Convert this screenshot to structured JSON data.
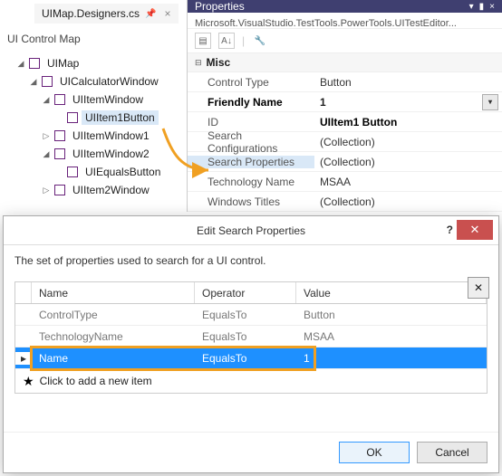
{
  "tab": {
    "title": "UIMap.Designers.cs"
  },
  "leftPanel": {
    "title": "UI Control Map"
  },
  "tree": {
    "n0": "UIMap",
    "n1": "UICalculatorWindow",
    "n2": "UIItemWindow",
    "n3": "UIItem1Button",
    "n4": "UIItemWindow1",
    "n5": "UIItemWindow2",
    "n6": "UIEqualsButton",
    "n7": "UIItem2Window"
  },
  "props": {
    "title": "Properties",
    "sub": "Microsoft.VisualStudio.TestTools.PowerTools.UITestEditor...",
    "cat": "Misc",
    "rows": {
      "controlTypeL": "Control Type",
      "controlTypeV": "Button",
      "friendlyL": "Friendly Name",
      "friendlyV": "1",
      "idL": "ID",
      "idV": "UIItem1 Button",
      "searchCfgL": "Search Configurations",
      "searchCfgV": "(Collection)",
      "searchPropL": "Search Properties",
      "searchPropV": "(Collection)",
      "techL": "Technology Name",
      "techV": "MSAA",
      "winTitlesL": "Windows Titles",
      "winTitlesV": "(Collection)"
    }
  },
  "dialog": {
    "title": "Edit Search Properties",
    "desc": "The set of properties used to search for a UI control.",
    "cols": {
      "name": "Name",
      "op": "Operator",
      "val": "Value"
    },
    "rows": [
      {
        "name": "ControlType",
        "op": "EqualsTo",
        "val": "Button"
      },
      {
        "name": "TechnologyName",
        "op": "EqualsTo",
        "val": "MSAA"
      },
      {
        "name": "Name",
        "op": "EqualsTo",
        "val": "1"
      }
    ],
    "addHint": "Click to add a new item",
    "ok": "OK",
    "cancel": "Cancel"
  }
}
